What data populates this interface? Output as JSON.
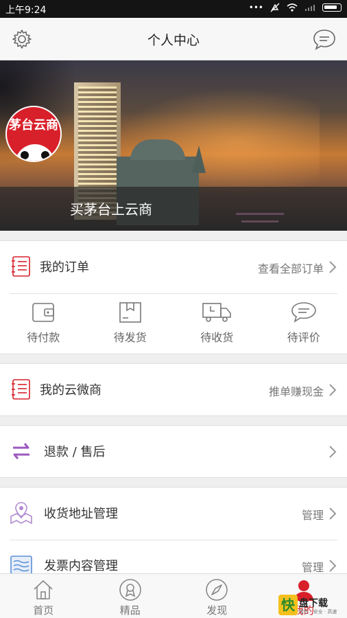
{
  "status_bar": {
    "time": "上午9:24"
  },
  "header": {
    "title": "个人中心"
  },
  "banner": {
    "avatar_text": "茅台云商",
    "store_name": "买茅台上云商"
  },
  "my_orders": {
    "label": "我的订单",
    "link": "查看全部订单",
    "statuses": [
      {
        "label": "待付款",
        "icon": "wallet-icon"
      },
      {
        "label": "待发货",
        "icon": "package-icon"
      },
      {
        "label": "待收货",
        "icon": "truck-icon"
      },
      {
        "label": "待评价",
        "icon": "comment-icon"
      }
    ]
  },
  "my_micro_store": {
    "label": "我的云微商",
    "link": "推单赚现金"
  },
  "refund": {
    "label": "退款 / 售后"
  },
  "address": {
    "label": "收货地址管理",
    "link": "管理"
  },
  "invoice": {
    "label": "发票内容管理",
    "link": "管理"
  },
  "tabs": [
    {
      "label": "首页",
      "icon": "home-icon"
    },
    {
      "label": "精品",
      "icon": "award-icon"
    },
    {
      "label": "发现",
      "icon": "compass-icon"
    },
    {
      "label": "我的",
      "icon": "user-icon",
      "active": true
    }
  ],
  "watermark": {
    "badge": "快",
    "main": "盘下载",
    "sub": "绿色 · 安全 · 高速"
  },
  "colors": {
    "accent": "#d8202a",
    "purple": "#9b59c0",
    "blue": "#5b8fd6"
  }
}
